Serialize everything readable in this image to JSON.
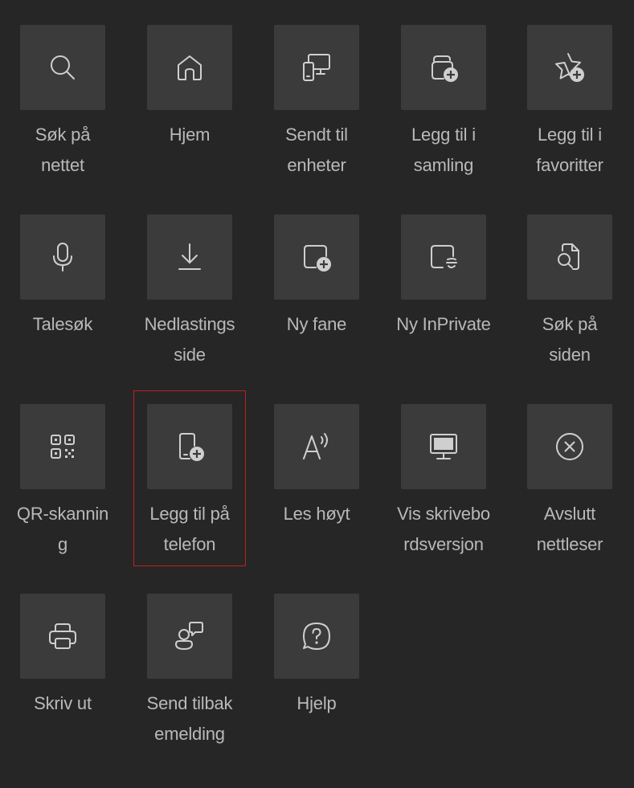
{
  "tiles": [
    {
      "name": "search-web",
      "icon": "search-icon",
      "label": "Søk på\nnettet"
    },
    {
      "name": "home",
      "icon": "home-icon",
      "label": "Hjem"
    },
    {
      "name": "sent-to-devices",
      "icon": "devices-icon",
      "label": "Sendt til\nenheter"
    },
    {
      "name": "add-to-collection",
      "icon": "collection-add-icon",
      "label": "Legg til i\nsamling"
    },
    {
      "name": "add-to-favorites",
      "icon": "star-add-icon",
      "label": "Legg til i\nfavoritter"
    },
    {
      "name": "voice-search",
      "icon": "microphone-icon",
      "label": "Talesøk"
    },
    {
      "name": "downloads-page",
      "icon": "download-icon",
      "label": "Nedlastings\nside"
    },
    {
      "name": "new-tab",
      "icon": "new-tab-icon",
      "label": "Ny fane"
    },
    {
      "name": "new-inprivate",
      "icon": "inprivate-icon",
      "label": "Ny InPrivate"
    },
    {
      "name": "find-on-page",
      "icon": "find-page-icon",
      "label": "Søk på\nsiden"
    },
    {
      "name": "qr-scanning",
      "icon": "qr-code-icon",
      "label": "QR-skannin\ng"
    },
    {
      "name": "add-to-phone",
      "icon": "phone-add-icon",
      "label": "Legg til på\ntelefon"
    },
    {
      "name": "read-aloud",
      "icon": "read-aloud-icon",
      "label": "Les høyt"
    },
    {
      "name": "desktop-version",
      "icon": "desktop-icon",
      "label": "Vis skrivebo\nrdsversjon"
    },
    {
      "name": "exit-browser",
      "icon": "close-circle-icon",
      "label": "Avslutt\nnettleser"
    },
    {
      "name": "print",
      "icon": "printer-icon",
      "label": "Skriv ut"
    },
    {
      "name": "send-feedback",
      "icon": "feedback-icon",
      "label": "Send tilbak\nemelding"
    },
    {
      "name": "help",
      "icon": "help-icon",
      "label": "Hjelp"
    }
  ],
  "highlighted_tile": "add-to-phone",
  "colors": {
    "background": "#262626",
    "tile": "#3b3b3b",
    "icon": "#cfcfcf",
    "label": "#b9b9b9",
    "highlight": "#c01f1f"
  }
}
